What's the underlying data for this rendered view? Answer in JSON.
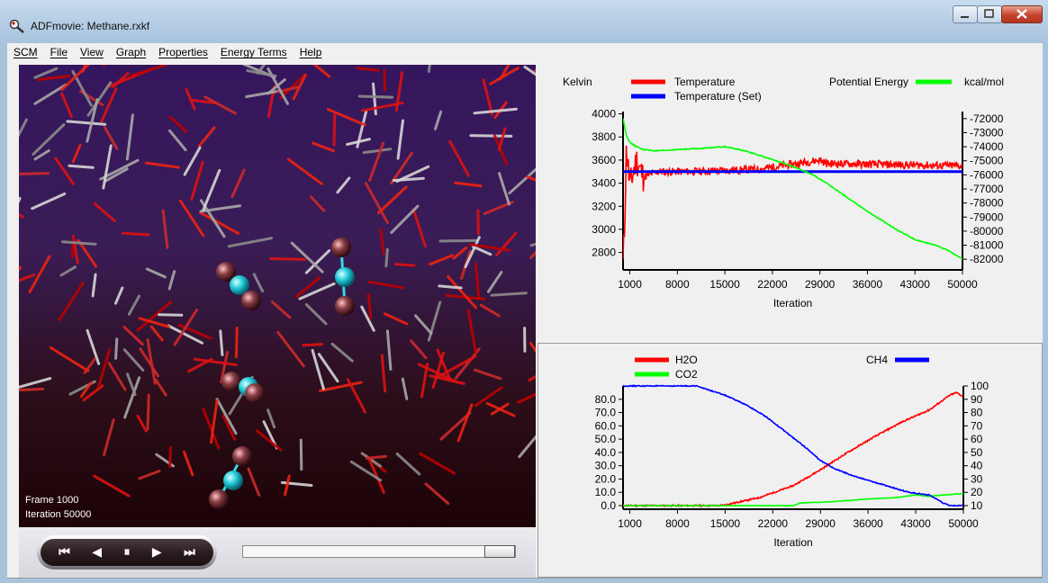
{
  "window": {
    "title": "ADFmovie: Methane.rxkf"
  },
  "menu": [
    "SCM",
    "File",
    "View",
    "Graph",
    "Properties",
    "Energy Terms",
    "Help"
  ],
  "viewer": {
    "frame_label": "Frame 1000",
    "iteration_label": "Iteration 50000"
  },
  "player": {
    "first_icon": "⏮",
    "prev_icon": "◀",
    "pause_icon": "⏸",
    "next_icon": "▶",
    "last_icon": "⏭",
    "position_fraction": 1.0
  },
  "chart_data": [
    {
      "type": "line",
      "xlabel": "Iteration",
      "ylabel_left": "Kelvin",
      "ylabel_right": "kcal/mol",
      "x_ticks": [
        1000,
        8000,
        15000,
        22000,
        29000,
        36000,
        43000,
        50000
      ],
      "y_left_ticks": [
        2800,
        3000,
        3200,
        3400,
        3600,
        3800,
        4000
      ],
      "y_right_ticks": [
        -72000,
        -73000,
        -74000,
        -75000,
        -76000,
        -77000,
        -78000,
        -79000,
        -80000,
        -81000,
        -82000
      ],
      "ylim_left": [
        2680,
        4020
      ],
      "ylim_right": [
        -82500,
        -71500
      ],
      "xlim": [
        0,
        50000
      ],
      "series": [
        {
          "name": "Temperature",
          "axis": "left",
          "color": "#ff0000",
          "x": [
            0,
            200,
            500,
            1000,
            2000,
            3000,
            5000,
            10000,
            20000,
            29000,
            30000,
            40000,
            50000
          ],
          "values": [
            2700,
            3000,
            3700,
            3380,
            3600,
            3450,
            3500,
            3500,
            3520,
            3600,
            3570,
            3560,
            3550
          ]
        },
        {
          "name": "Temperature (Set)",
          "axis": "left",
          "color": "#0000ff",
          "x": [
            0,
            50000
          ],
          "values": [
            3500,
            3500
          ]
        },
        {
          "name": "Potential Energy",
          "axis": "right",
          "color": "#00ff00",
          "x": [
            0,
            500,
            1000,
            2000,
            3000,
            5000,
            8000,
            12000,
            15000,
            18000,
            22000,
            25000,
            28000,
            30000,
            33000,
            36000,
            40000,
            43000,
            46000,
            48000,
            50000
          ],
          "values": [
            -72000,
            -73200,
            -73700,
            -74000,
            -74200,
            -74300,
            -74200,
            -74100,
            -74000,
            -74300,
            -74900,
            -75400,
            -76000,
            -76600,
            -77600,
            -78600,
            -79800,
            -80600,
            -81000,
            -81400,
            -82000
          ]
        }
      ]
    },
    {
      "type": "line",
      "xlabel": "Iteration",
      "x_ticks": [
        1000,
        8000,
        15000,
        22000,
        29000,
        36000,
        43000,
        50000
      ],
      "y_left_ticks": [
        "0.0",
        "10.0",
        "20.0",
        "30.0",
        "40.0",
        "50.0",
        "60.0",
        "70.0",
        "80.0"
      ],
      "y_right_ticks": [
        10,
        20,
        30,
        40,
        50,
        60,
        70,
        80,
        90,
        100
      ],
      "ylim_left": [
        0,
        90
      ],
      "ylim_right": [
        10,
        100
      ],
      "xlim": [
        0,
        50000
      ],
      "series": [
        {
          "name": "H2O",
          "axis": "left",
          "color": "#ff0000",
          "x": [
            0,
            14000,
            15000,
            20000,
            25000,
            29000,
            33000,
            37000,
            41000,
            45000,
            48000,
            49000,
            50000
          ],
          "values": [
            0,
            0,
            0.5,
            6,
            15,
            27,
            40,
            52,
            63,
            72,
            83,
            85,
            82
          ]
        },
        {
          "name": "CO2",
          "axis": "left",
          "color": "#00ff00",
          "x": [
            0,
            25000,
            26000,
            31000,
            36000,
            40000,
            43000,
            45000,
            47000,
            50000
          ],
          "values": [
            0,
            0,
            2,
            3,
            5,
            6,
            8,
            7,
            8,
            9
          ]
        },
        {
          "name": "CH4",
          "axis": "right",
          "color": "#0000ff",
          "x": [
            0,
            11000,
            12000,
            15000,
            18000,
            21000,
            24000,
            27000,
            29000,
            31000,
            34000,
            38000,
            42000,
            45000,
            47000,
            48000,
            50000
          ],
          "values": [
            100,
            100,
            98,
            93,
            86,
            77,
            65,
            53,
            44,
            38,
            32,
            26,
            20,
            18,
            12,
            10,
            10
          ]
        }
      ]
    }
  ]
}
